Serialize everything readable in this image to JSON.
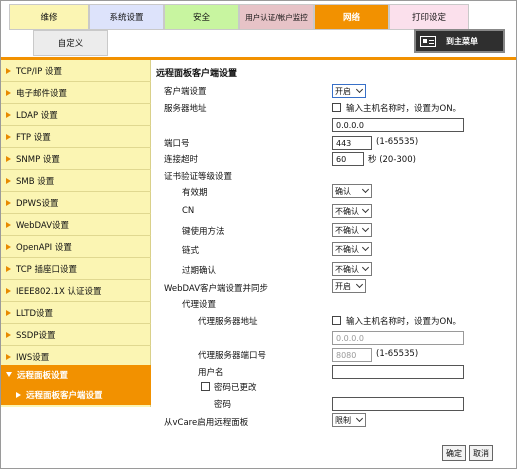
{
  "tabs": [
    {
      "label": "维修",
      "bg": "#fbf5b3"
    },
    {
      "label": "系统设置",
      "bg": "#dde3fb"
    },
    {
      "label": "安全",
      "bg": "#c8f5a0"
    },
    {
      "label": "用户认证/帐户监控",
      "bg": "#e7c3c7"
    },
    {
      "label": "网络",
      "bg": "#f29100"
    },
    {
      "label": "打印设定",
      "bg": "#fbe0ec"
    }
  ],
  "sub_tab": "自定义",
  "main_menu_label": "到主菜单",
  "sidebar": [
    "TCP/IP 设置",
    "电子邮件设置",
    "LDAP 设置",
    "FTP 设置",
    "SNMP 设置",
    "SMB 设置",
    "DPWS设置",
    "WebDAV设置",
    "OpenAPI 设置",
    "TCP 插座口设置",
    "IEEE802.1X 认证设置",
    "LLTD设置",
    "SSDP设置",
    "IWS设置",
    "远程面板设置"
  ],
  "sidebar_sub": "远程面板客户端设置",
  "form": {
    "title": "远程面板客户端设置",
    "client_setting_label": "客户端设置",
    "client_setting_value": "开启",
    "server_address_label": "服务器地址",
    "host_checkbox_label": "输入主机名称时，设置为ON。",
    "server_address_value": "0.0.0.0",
    "port_label": "端口号",
    "port_value": "443",
    "port_range": "(1-65535)",
    "timeout_label": "连接超时",
    "timeout_value": "60",
    "timeout_unit": "秒 (20-300)",
    "cert_label": "证书验证等级设置",
    "validity_label": "有效期",
    "validity_value": "确认",
    "cn_label": "CN",
    "cn_value": "不确认",
    "key_usage_label": "键使用方法",
    "key_usage_value": "不确认",
    "chain_label": "链式",
    "chain_value": "不确认",
    "expiry_label": "过期确认",
    "expiry_value": "不确认",
    "webdav_label": "WebDAV客户端设置并同步",
    "webdav_value": "开启",
    "proxy_label": "代理设置",
    "proxy_server_label": "代理服务器地址",
    "proxy_host_checkbox_label": "输入主机名称时，设置为ON。",
    "proxy_server_value": "0.0.0.0",
    "proxy_port_label": "代理服务器端口号",
    "proxy_port_value": "8080",
    "proxy_port_range": "(1-65535)",
    "username_label": "用户名",
    "username_value": "",
    "password_changed_label": "密码已更改",
    "password_label": "密码",
    "password_value": "",
    "vcare_label": "从vCare启用远程面板",
    "vcare_value": "限制"
  },
  "buttons": {
    "ok": "确定",
    "cancel": "取消"
  }
}
